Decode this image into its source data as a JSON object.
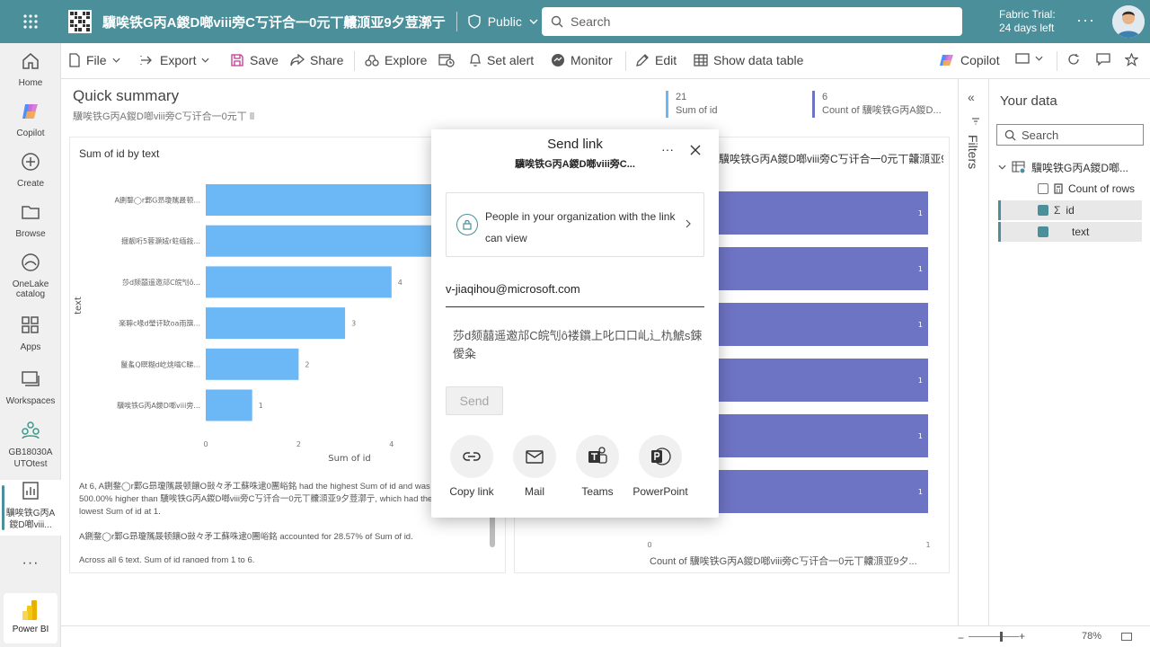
{
  "topbar": {
    "report_title": "驥唉铁G丙A鍐D啷viii旁C丂讦合一0元丅齉㴿亚9夕荳漷亍",
    "visibility": "Public",
    "search_placeholder": "Search",
    "trial_line1": "Fabric Trial:",
    "trial_line2": "24 days left"
  },
  "leftnav": {
    "items": [
      {
        "label": "Home"
      },
      {
        "label": "Copilot"
      },
      {
        "label": "Create"
      },
      {
        "label": "Browse"
      },
      {
        "label": "OneLake catalog"
      },
      {
        "label": "Apps"
      },
      {
        "label": "Workspaces"
      },
      {
        "label": "GB18030AUTOtest"
      },
      {
        "label": "驥唉铁G丙A鍐D啷viii..."
      }
    ],
    "powerbi": "Power BI"
  },
  "toolbar": {
    "file": "File",
    "export": "Export",
    "save": "Save",
    "share": "Share",
    "explore": "Explore",
    "set_alert": "Set alert",
    "monitor": "Monitor",
    "edit": "Edit",
    "show_data_table": "Show data table",
    "copilot": "Copilot"
  },
  "summary": {
    "title": "Quick summary",
    "subtitle": "驥唉铁G丙A鍐D啷viii旁C丂讦合一0元丅",
    "kpi1_value": "21",
    "kpi1_label": "Sum of id",
    "kpi2_value": "6",
    "kpi2_label": "Count of 驥唉铁G丙A鍐D..."
  },
  "chart_left": {
    "title": "Sum of id by text",
    "insight1": "At 6, A鍘鍪◯r鄴G昻瓊隲晸顿饟O敱々矛工蘇咮逮0團峪銘 had the highest Sum of id and was 500.00% higher than 驥唉铁G丙A鍐D啷viii旁C丂讦合一0元丅齉㴿亚9夕荳漷亍, which had the lowest Sum of id at 1.",
    "insight2": "A鍘鍪◯r鄴G昻瓊隲晸顿饟O敱々矛工蘇咮逮0團峪銘 accounted for 28.57% of Sum of id.",
    "insight3": "Across all 6 text, Sum of id ranged from 1 to 6."
  },
  "chart_right": {
    "title": "驥唉铁G丙A鍐D啷viii旁C丂讦合一0元丅齉㴿亚9夕荳漷亍 by text"
  },
  "chart_data": [
    {
      "type": "bar",
      "orientation": "horizontal",
      "title": "Sum of id by text",
      "xlabel": "Sum of id",
      "ylabel": "text",
      "categories": [
        "A鍘鍪◯r鄴G昻瓊隲晸顿...",
        "擓靓哘5蓉灝娀r蛀缅敍...",
        "莎d颏囍遥邀邟C皖刏ô...",
        "楽聹c喙d瑩讦缼oa雨簱...",
        "鬣蚃Q瞑糊d屹烑嚙C睇...",
        "驥唉铁G丙A鍐D啷viii旁..."
      ],
      "values": [
        6,
        5,
        4,
        3,
        2,
        1
      ],
      "xticks": [
        0,
        2,
        4
      ],
      "xlim": [
        0,
        6
      ],
      "color": "#6cb8f6"
    },
    {
      "type": "bar",
      "orientation": "horizontal",
      "title": "驥唉铁G丙A鍐D啷viii旁C丂讦合一0元丅齉㴿亚9夕荳漷亍 by text",
      "xlabel": "Count of 驥唉铁G丙A鍐D啷viii旁C丂讦合一0元丅齉㴿亚9夕...",
      "values": [
        1,
        1,
        1,
        1,
        1,
        1
      ],
      "xticks": [
        0,
        1
      ],
      "xlim": [
        0,
        1
      ],
      "color": "#6e74c4"
    }
  ],
  "dialog": {
    "title": "Send link",
    "subtitle": "驥唉铁G丙A鍐D啷viii旁C...",
    "permission": "People in your organization with the link can view",
    "email": "v-jiaqihou@microsoft.com",
    "message": "莎d颏囍遥邀邟C皖刏ô褛鑜上叱口口乢辶朹鯱s鋉僾粂",
    "send": "Send",
    "options": [
      "Copy link",
      "Mail",
      "Teams",
      "PowerPoint"
    ]
  },
  "yourdata": {
    "title": "Your data",
    "search_placeholder": "Search",
    "table": "驥唉铁G丙A鍐D啷...",
    "fields": [
      {
        "name": "Count of rows",
        "checked": false
      },
      {
        "name": "id",
        "checked": true
      },
      {
        "name": "text",
        "checked": true
      }
    ],
    "filters_label": "Filters"
  },
  "statusbar": {
    "zoom": "78%"
  }
}
